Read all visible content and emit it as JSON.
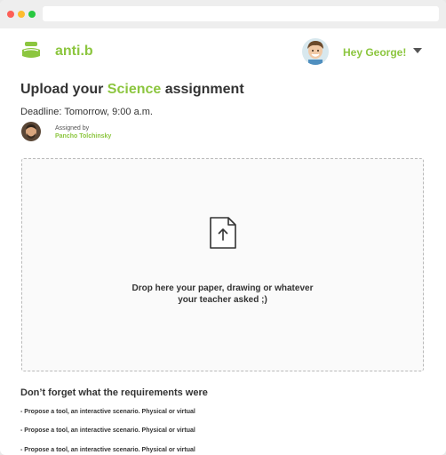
{
  "header": {
    "brand": "anti.b",
    "greeting": "Hey George!",
    "logo_icon": "app-logo-icon",
    "menu_icon": "chevron-down-icon"
  },
  "assignment": {
    "title_prefix": "Upload your",
    "subject": "Science",
    "title_suffix": "assignment",
    "deadline": "Deadline: Tomorrow, 9:00 a.m.",
    "assigned_by_label": "Assigned by",
    "teacher": "Pancho Tolchinsky"
  },
  "dropzone": {
    "icon": "file-upload-icon",
    "line1": "Drop here your paper, drawing or whatever",
    "line2": "your teacher asked ;)"
  },
  "requirements": {
    "heading": "Don’t forget what the requirements were",
    "items": [
      "- Propose a tool, an interactive scenario. Physical or virtual",
      "- Propose a tool, an interactive scenario. Physical or virtual",
      "- Propose a tool, an interactive scenario. Physical or virtual"
    ]
  },
  "colors": {
    "accent": "#8cc63f",
    "text": "#333333",
    "dropzone_border": "#b9b9b9"
  }
}
